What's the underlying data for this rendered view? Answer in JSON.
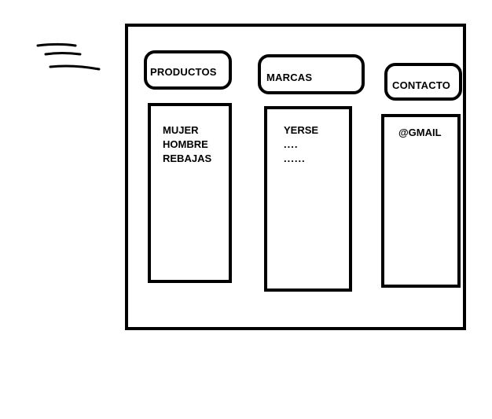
{
  "menu": {
    "icon": "hamburger-menu-icon"
  },
  "tabs": [
    {
      "label": "PRODUCTOS"
    },
    {
      "label": "MARCAS"
    },
    {
      "label": "CONTACTO"
    }
  ],
  "panels": {
    "productos": {
      "items": [
        "MUJER",
        "HOMBRE",
        "REBAJAS"
      ]
    },
    "marcas": {
      "items": [
        "YERSE",
        "....",
        "......"
      ]
    },
    "contacto": {
      "items": [
        "@GMAIL"
      ]
    }
  }
}
